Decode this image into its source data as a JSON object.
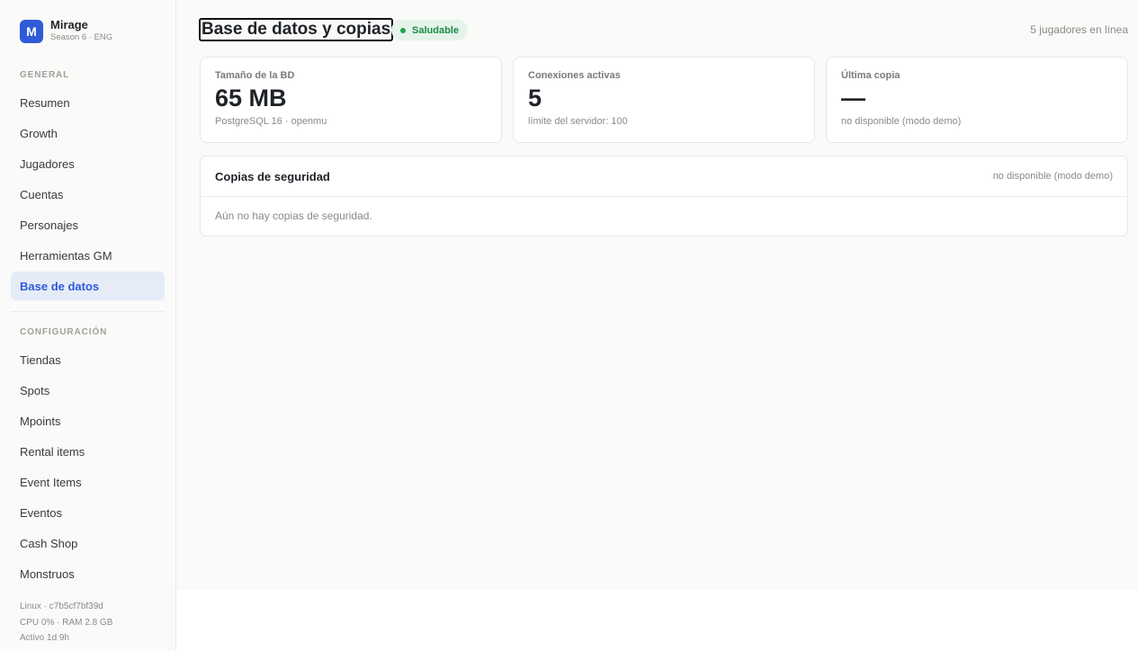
{
  "brand": {
    "initial": "M",
    "name": "Mirage",
    "subtitle": "Season 6 · ENG"
  },
  "sidebar": {
    "general_title": "GENERAL",
    "general_items": [
      {
        "label": "Resumen",
        "active": false
      },
      {
        "label": "Growth",
        "active": false
      },
      {
        "label": "Jugadores",
        "active": false
      },
      {
        "label": "Cuentas",
        "active": false
      },
      {
        "label": "Personajes",
        "active": false
      },
      {
        "label": "Herramientas GM",
        "active": false
      },
      {
        "label": "Base de datos",
        "active": true
      }
    ],
    "config_title": "CONFIGURACIÓN",
    "config_items": [
      {
        "label": "Tiendas"
      },
      {
        "label": "Spots"
      },
      {
        "label": "Mpoints"
      },
      {
        "label": "Rental items"
      },
      {
        "label": "Event Items"
      },
      {
        "label": "Eventos"
      },
      {
        "label": "Cash Shop"
      },
      {
        "label": "Monstruos"
      }
    ],
    "system": {
      "host": "Linux · c7b5cf7bf39d",
      "resources": "CPU 0% · RAM 2.8 GB",
      "uptime": "Activo 1d 9h"
    }
  },
  "header": {
    "title": "Base de datos y copias",
    "status_badge": "Saludable",
    "online": "5 jugadores en línea"
  },
  "cards": [
    {
      "label": "Tamaño de la BD",
      "value": "65 MB",
      "sub": "PostgreSQL 16 · openmu"
    },
    {
      "label": "Conexiones activas",
      "value": "5",
      "sub": "límite del servidor: 100"
    },
    {
      "label": "Última copia",
      "value": "—",
      "sub": "no disponible (modo demo)"
    }
  ],
  "backups": {
    "title": "Copias de seguridad",
    "note": "no disponible (modo demo)",
    "empty": "Aún no hay copias de seguridad."
  },
  "colors": {
    "accent": "#2f5bd8",
    "success": "#1e8a46",
    "success_bg": "#e5f4ea"
  }
}
